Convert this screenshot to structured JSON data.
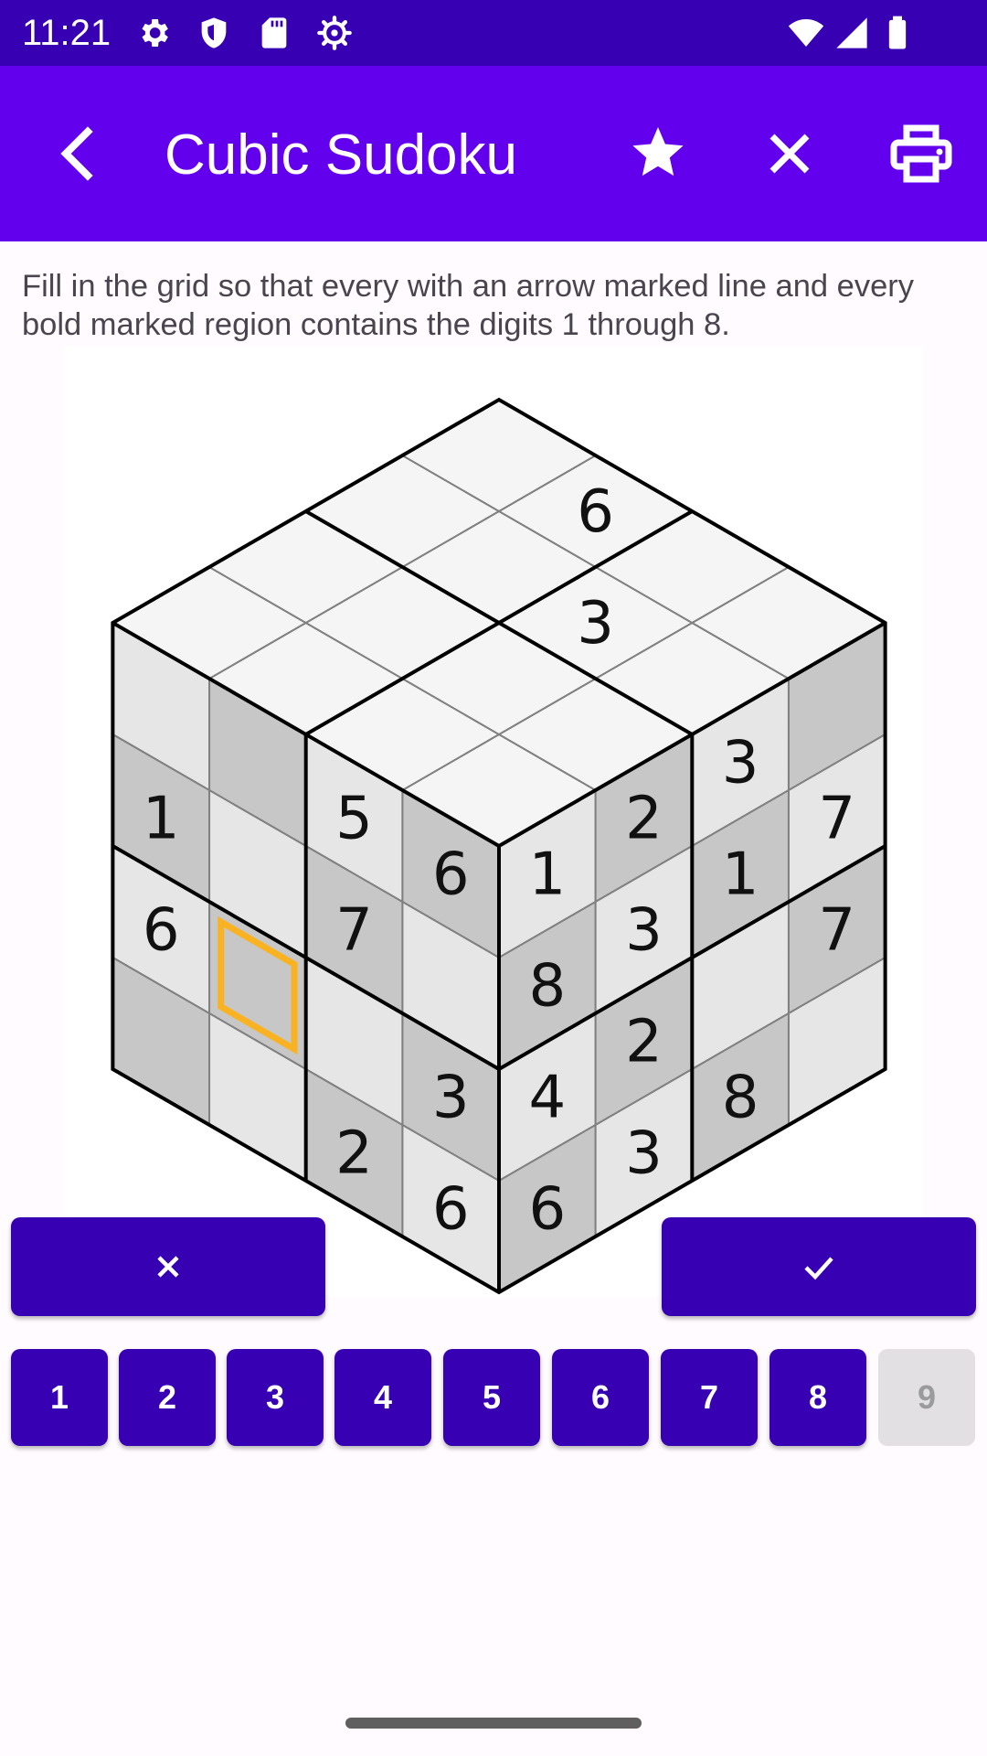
{
  "status_bar": {
    "time": "11:21",
    "left_icons": [
      "settings-icon",
      "shield-icon",
      "sd-card-icon",
      "settings-gear-icon"
    ],
    "right_icons": [
      "wifi-icon",
      "signal-icon",
      "battery-icon"
    ]
  },
  "app_bar": {
    "title": "Cubic Sudoku",
    "actions": [
      "back-arrow-icon",
      "star-icon",
      "close-icon",
      "print-icon"
    ]
  },
  "instructions": "Fill in the grid so that every with an arrow marked line and every bold marked region contains the digits 1 through 8.",
  "colors": {
    "status_bar": "#3700b3",
    "app_bar": "#6200ee",
    "button": "#3700b3",
    "selection": "#f9b322",
    "face_top": "#f5f5f5",
    "face_light": "#e6e6e6",
    "face_dark": "#c7c7c7"
  },
  "puzzle": {
    "faces": {
      "top": [
        [
          "",
          "",
          "",
          ""
        ],
        [
          "",
          "",
          "3",
          ""
        ],
        [
          "",
          "",
          "",
          "6"
        ],
        [
          "",
          "",
          "",
          ""
        ]
      ],
      "left": [
        [
          "6",
          "5",
          "",
          ""
        ],
        [
          "",
          "7",
          "",
          "1"
        ],
        [
          "3",
          "",
          "",
          "6"
        ],
        [
          "6",
          "2",
          "",
          ""
        ]
      ],
      "right": [
        [
          "1",
          "2",
          "3",
          ""
        ],
        [
          "8",
          "3",
          "1",
          "7"
        ],
        [
          "4",
          "2",
          "",
          "7"
        ],
        [
          "6",
          "3",
          "8",
          ""
        ]
      ]
    },
    "selected_cell": "left-face-r2-c2"
  },
  "controls": {
    "clear_icon": "close-icon",
    "confirm_icon": "check-icon",
    "digits": [
      {
        "label": "1",
        "enabled": true
      },
      {
        "label": "2",
        "enabled": true
      },
      {
        "label": "3",
        "enabled": true
      },
      {
        "label": "4",
        "enabled": true
      },
      {
        "label": "5",
        "enabled": true
      },
      {
        "label": "6",
        "enabled": true
      },
      {
        "label": "7",
        "enabled": true
      },
      {
        "label": "8",
        "enabled": true
      },
      {
        "label": "9",
        "enabled": false
      }
    ]
  }
}
